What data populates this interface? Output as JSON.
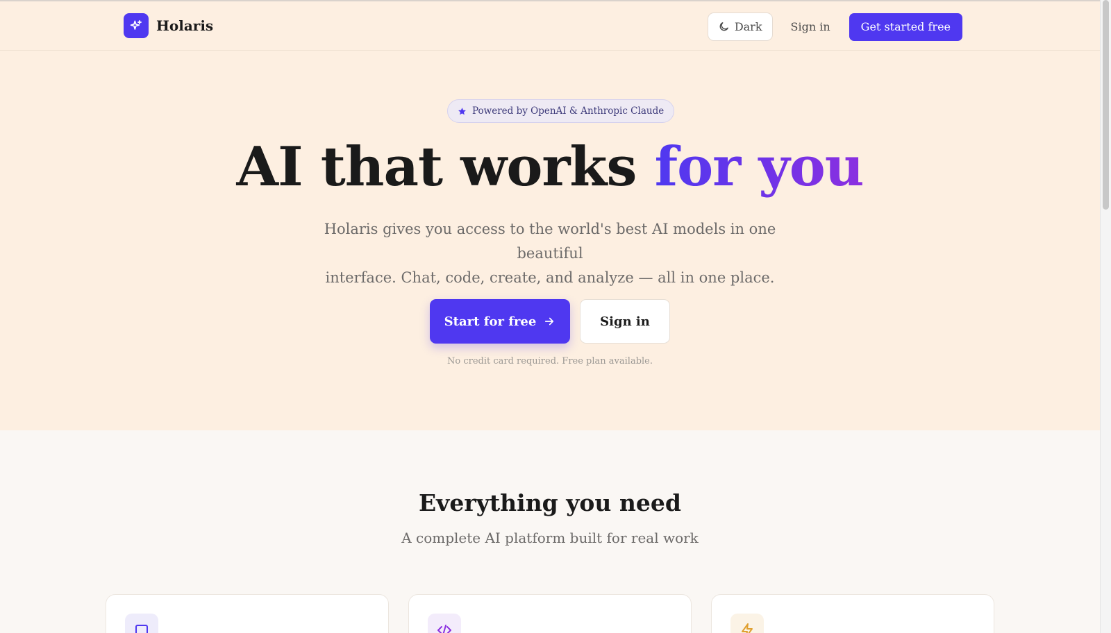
{
  "header": {
    "brand_name": "Holaris",
    "theme_toggle_label": "Dark",
    "signin_label": "Sign in",
    "cta_label": "Get started free"
  },
  "hero": {
    "badge_text": "Powered by OpenAI & Anthropic Claude",
    "title_main": "AI that works ",
    "title_accent": "for you",
    "subtitle_line1": "Holaris gives you access to the world's best AI models in one beautiful",
    "subtitle_line2": "interface. Chat, code, create, and analyze — all in one place.",
    "primary_cta": "Start for free",
    "secondary_cta": "Sign in",
    "note": "No credit card required. Free plan available."
  },
  "features": {
    "title": "Everything you need",
    "subtitle": "A complete AI platform built for real work",
    "cards": [
      {
        "icon": "chat-icon",
        "icon_color": "#4f38f0",
        "icon_bg": "#eeecfb"
      },
      {
        "icon": "code-icon",
        "icon_color": "#8b2fe0",
        "icon_bg": "#f3ecfb"
      },
      {
        "icon": "lightning-icon",
        "icon_color": "#e0a030",
        "icon_bg": "#fbf3e6"
      }
    ]
  },
  "colors": {
    "accent": "#4f38f0",
    "accent_gradient_end": "#8b2fe0",
    "hero_bg": "#fdefe1",
    "page_bg": "#faf7f4"
  }
}
